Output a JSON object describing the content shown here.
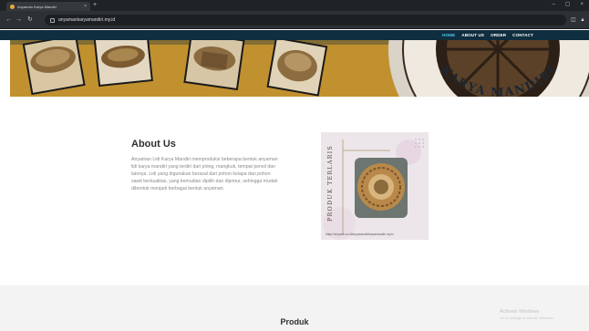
{
  "browser": {
    "tab_title": "Anyaman Karya Mandiri",
    "tab_close": "×",
    "new_tab": "+",
    "url": "anyamankaryamandiri.my.id",
    "window_controls": [
      "–",
      "▢",
      "×"
    ],
    "nav_icons": [
      "arrow-left-icon",
      "arrow-right-icon",
      "reload-icon"
    ]
  },
  "site_nav": {
    "links": [
      "HOME",
      "ABOUT US",
      "ORDER",
      "CONTACT"
    ],
    "active_index": 0
  },
  "hero": {
    "logo_text": "KARYA MANDIRI"
  },
  "about": {
    "title": "About Us",
    "body": "Anyaman Lidi Karya Mandiri memproduksi beberapa bentuk anyaman lidi karya mandiri yang terdiri dari piring, mangkuk, tempat pensil dan lainnya. Lidi yang digunakan berasal dari pohon kelapa dan pohon sawit berkualitas, yang kemudian dipilih dan dijemur, sehingga mudah dibentuk menjadi berbagai bentuk anyaman."
  },
  "promo": {
    "vertical_label": "PRODUK TERLARIS",
    "handle": "https://shopee.co.id/anyamanlidikaryamandiri.my.id"
  },
  "produk": {
    "title": "Produk"
  },
  "windows_watermark": {
    "title": "Activate Windows",
    "subtitle": "Go to Settings to activate Windows."
  },
  "colors": {
    "nav_bg": "#0f2e3f",
    "nav_active": "#56c8ea",
    "hero_mustard": "#c2912f"
  }
}
